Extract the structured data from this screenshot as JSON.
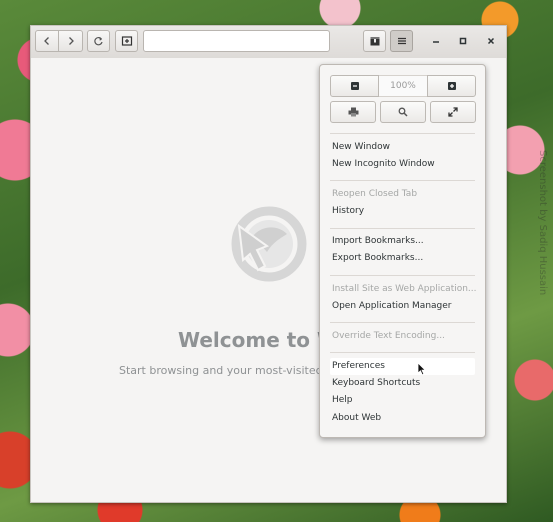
{
  "window": {
    "address": "",
    "controls": [
      "minimize",
      "maximize",
      "close"
    ]
  },
  "content": {
    "welcome_title": "Welcome to W",
    "welcome_subtitle": "Start browsing and your most-visited sit"
  },
  "menu": {
    "zoom_level": "100%",
    "groups": [
      [
        {
          "label": "New Window",
          "enabled": true
        },
        {
          "label": "New Incognito Window",
          "enabled": true
        }
      ],
      [
        {
          "label": "Reopen Closed Tab",
          "enabled": false
        },
        {
          "label": "History",
          "enabled": true
        }
      ],
      [
        {
          "label": "Import Bookmarks...",
          "enabled": true
        },
        {
          "label": "Export Bookmarks...",
          "enabled": true
        }
      ],
      [
        {
          "label": "Install Site as Web Application...",
          "enabled": false
        },
        {
          "label": "Open Application Manager",
          "enabled": true
        }
      ],
      [
        {
          "label": "Override Text Encoding...",
          "enabled": false
        }
      ],
      [
        {
          "label": "Preferences",
          "enabled": true,
          "hovered": true
        },
        {
          "label": "Keyboard Shortcuts",
          "enabled": true
        },
        {
          "label": "Help",
          "enabled": true
        },
        {
          "label": "About Web",
          "enabled": true
        }
      ]
    ]
  },
  "watermark": "Screenshot by Sadiq Hussain"
}
